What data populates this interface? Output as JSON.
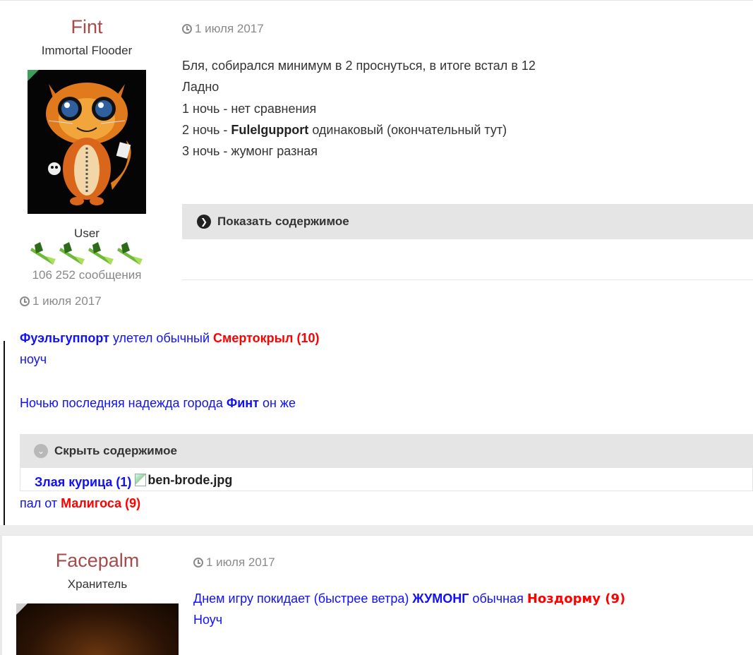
{
  "posts": [
    {
      "author": "Fint",
      "author_title": "Immortal Flooder",
      "rank": "User",
      "posts_count": "106 252 сообщения",
      "date": "1 июля 2017",
      "lines": [
        "Бля, собирался минимум в 2 проснуться, в итоге встал в 12",
        "Ладно",
        "1 ночь - нет сравнения",
        "2 ночь - ",
        "Fulelgupport",
        " одинаковый (окончательный тут)",
        "3 ночь - жумонг разная"
      ],
      "spoiler_label": "Показать содержимое",
      "quote": {
        "date": "1 июля 2017",
        "line1": [
          "Фуэльгуппорт",
          " улетел обычный ",
          "Смертокрыл (10)"
        ],
        "line2": "ноуч",
        "line3": [
          "Ночью последняя надежда города ",
          "Финт",
          " он же"
        ],
        "spoiler_label": "Скрыть содержимое",
        "spoiler_content": [
          "Злая курица (1)",
          "ben-brode.jpg"
        ],
        "after": [
          "пал от ",
          "Малигоса (9)"
        ]
      }
    },
    {
      "author": "Facepalm",
      "author_title": "Хранитель",
      "date": "1 июля 2017",
      "line1": [
        "Днем игру покидает (быстрее ветра) ",
        "ЖУМОНГ",
        " обычная ",
        "Ноздорму (9)"
      ],
      "line2": "Ноуч"
    }
  ],
  "colors": {
    "author": "#a74a4a",
    "blue": "#1010ff",
    "red": "#ff0000",
    "online": "#3d9e5a"
  },
  "icons": [
    "clock-icon",
    "chevron-right-circle-icon",
    "chevron-down-circle-icon",
    "broken-image-icon"
  ]
}
